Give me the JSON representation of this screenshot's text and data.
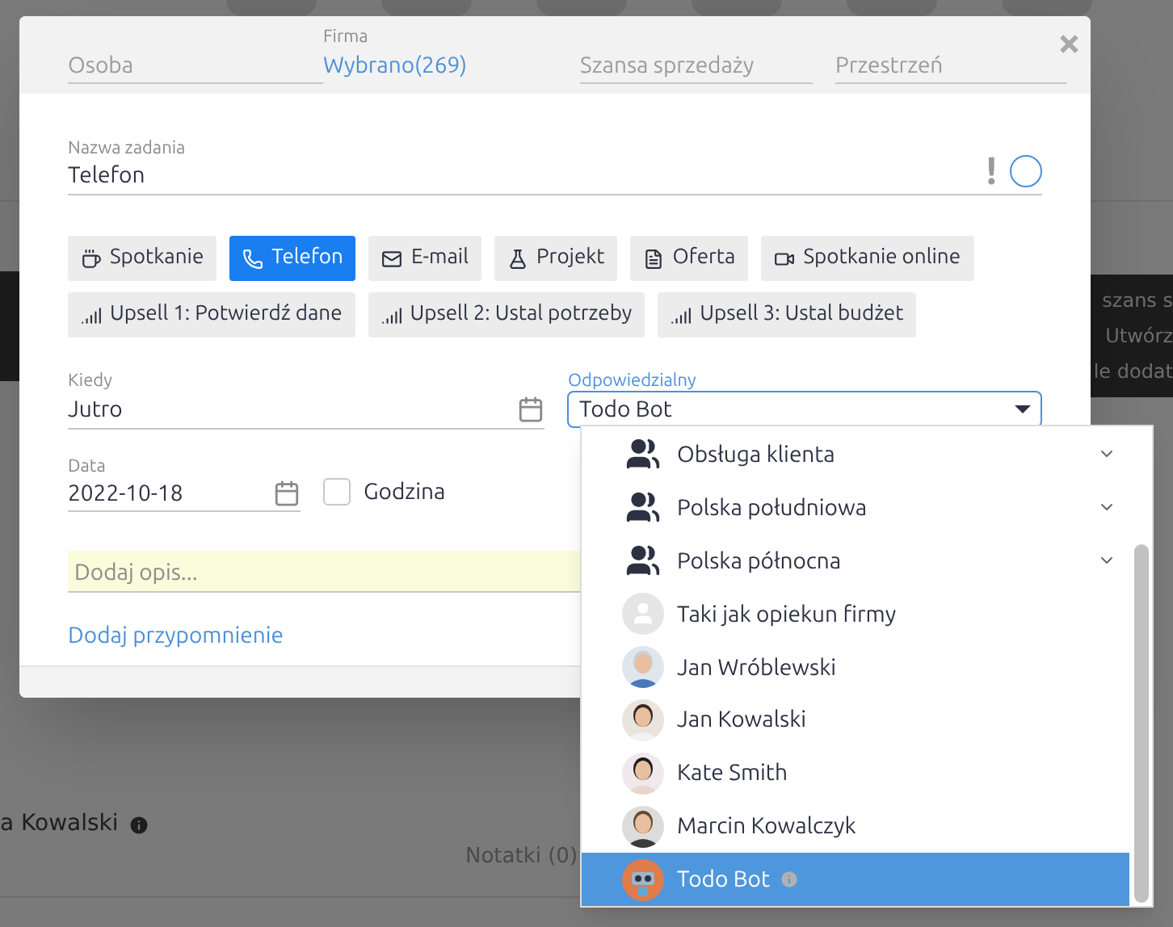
{
  "background": {
    "right_notice": [
      "szans s",
      "Utwórz",
      "le dodat"
    ],
    "contact_name": "a Kowalski",
    "notes_tab": "Notatki (0)"
  },
  "dialog": {
    "close": "×",
    "header_fields": [
      {
        "placeholder": "Osoba"
      },
      {
        "label": "Firma",
        "value": "Wybrano(269)"
      },
      {
        "placeholder": "Szansa sprzedaży"
      },
      {
        "placeholder": "Przestrzeń"
      }
    ],
    "task_name": {
      "label": "Nazwa zadania",
      "value": "Telefon",
      "priority_mark": "!",
      "done": false
    },
    "task_types": [
      {
        "label": "Spotkanie",
        "selected": false
      },
      {
        "label": "Telefon",
        "selected": true
      },
      {
        "label": "E-mail",
        "selected": false
      },
      {
        "label": "Projekt",
        "selected": false
      },
      {
        "label": "Oferta",
        "selected": false
      },
      {
        "label": "Spotkanie online",
        "selected": false
      },
      {
        "label": "Upsell 1: Potwierdź dane",
        "selected": false
      },
      {
        "label": "Upsell 2: Ustal potrzeby",
        "selected": false
      },
      {
        "label": "Upsell 3: Ustal budżet",
        "selected": false
      }
    ],
    "when": {
      "label": "Kiedy",
      "value": "Jutro"
    },
    "date": {
      "label": "Data",
      "value": "2022-10-18"
    },
    "time": {
      "label": "Godzina",
      "checked": false
    },
    "description": {
      "placeholder": "Dodaj opis..."
    },
    "reminder_link": "Dodaj przypomnienie",
    "responsible": {
      "label": "Odpowiedzialny",
      "value": "Todo Bot",
      "open": true,
      "options": [
        {
          "kind": "group",
          "label": "Obsługa klienta",
          "selected": false
        },
        {
          "kind": "group",
          "label": "Polska południowa",
          "selected": false
        },
        {
          "kind": "group",
          "label": "Polska północna",
          "selected": false
        },
        {
          "kind": "placeholder",
          "label": "Taki jak opiekun firmy",
          "selected": false
        },
        {
          "kind": "person",
          "label": "Jan Wróblewski",
          "selected": false
        },
        {
          "kind": "person",
          "label": "Jan Kowalski",
          "selected": false
        },
        {
          "kind": "person",
          "label": "Kate Smith",
          "selected": false
        },
        {
          "kind": "person",
          "label": "Marcin Kowalczyk",
          "selected": false
        },
        {
          "kind": "bot",
          "label": "Todo Bot",
          "selected": true
        }
      ]
    }
  }
}
